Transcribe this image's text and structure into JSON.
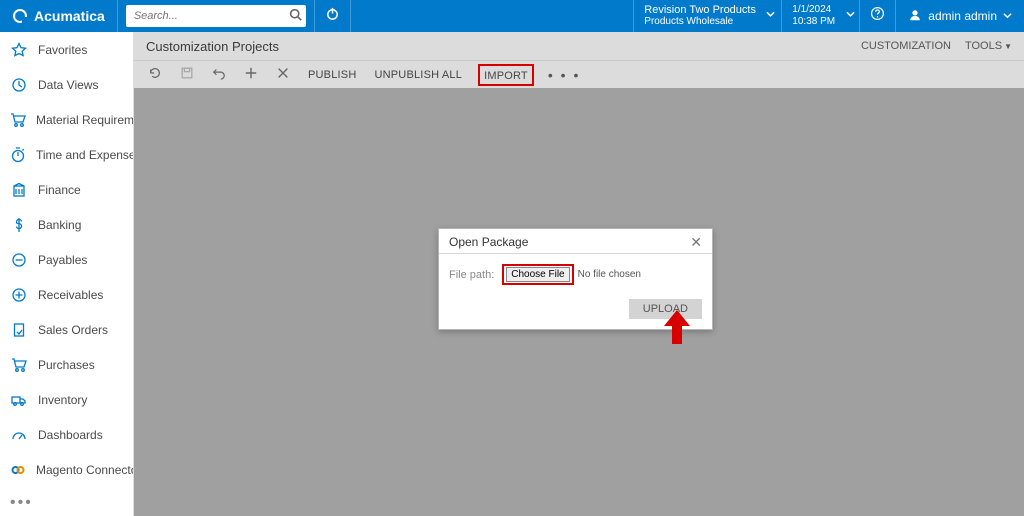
{
  "header": {
    "brand": "Acumatica",
    "search_placeholder": "Search...",
    "tenant_line1": "Revision Two Products",
    "tenant_line2": "Products Wholesale",
    "date": "1/1/2024",
    "time": "10:38 PM",
    "user": "admin admin"
  },
  "sidebar": {
    "items": [
      {
        "label": "Favorites"
      },
      {
        "label": "Data Views"
      },
      {
        "label": "Material Requirem…"
      },
      {
        "label": "Time and Expenses"
      },
      {
        "label": "Finance"
      },
      {
        "label": "Banking"
      },
      {
        "label": "Payables"
      },
      {
        "label": "Receivables"
      },
      {
        "label": "Sales Orders"
      },
      {
        "label": "Purchases"
      },
      {
        "label": "Inventory"
      },
      {
        "label": "Dashboards"
      },
      {
        "label": "Magento Connector"
      }
    ],
    "more": "•••"
  },
  "page": {
    "title": "Customization Projects",
    "links": {
      "customization": "CUSTOMIZATION",
      "tools": "TOOLS"
    }
  },
  "toolbar": {
    "publish": "PUBLISH",
    "unpublish_all": "UNPUBLISH ALL",
    "import": "IMPORT",
    "more": "• • •"
  },
  "dialog": {
    "title": "Open Package",
    "file_path_label": "File path:",
    "choose_file": "Choose File",
    "no_file": "No file chosen",
    "upload": "UPLOAD"
  }
}
